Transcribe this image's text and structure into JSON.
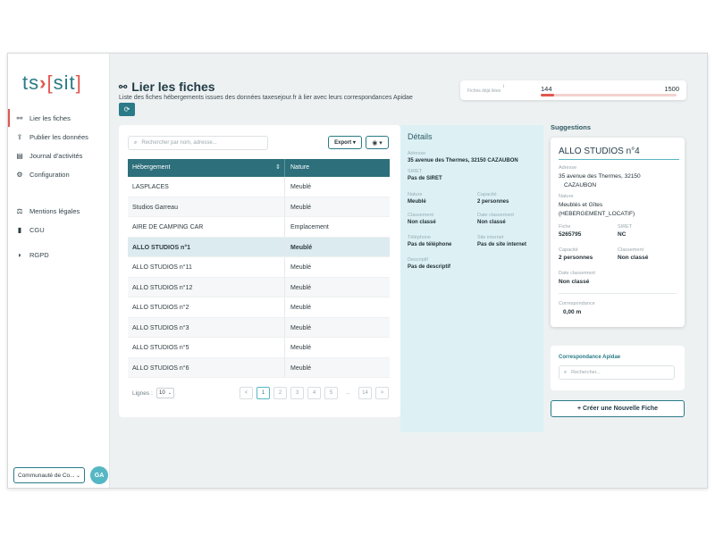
{
  "logo": {
    "left": "ts",
    "arrow": "›",
    "open": "[",
    "right": "sit",
    "close": "]"
  },
  "sidebar": {
    "items": [
      {
        "label": "Lier les fiches",
        "icon": "link-icon",
        "glyph": "⚯"
      },
      {
        "label": "Publier les données",
        "icon": "upload-icon",
        "glyph": "⇪"
      },
      {
        "label": "Journal d'activités",
        "icon": "journal-icon",
        "glyph": "▤"
      },
      {
        "label": "Configuration",
        "icon": "config-icon",
        "glyph": "⚙"
      },
      {
        "label": "Mentions légales",
        "icon": "legal-icon",
        "glyph": "⚖"
      },
      {
        "label": "CGU",
        "icon": "book-icon",
        "glyph": "▮"
      },
      {
        "label": "RGPD",
        "icon": "shield-icon",
        "glyph": "◗"
      }
    ],
    "org_select": "Communauté de Co...",
    "avatar": "GA"
  },
  "header": {
    "title": "Lier les fiches",
    "subtitle": "Liste des fiches hébergements issues des données taxesejour.fr à lier avec leurs correspondances Apidae",
    "refresh_glyph": "⟳"
  },
  "progress": {
    "label": "Fiches déjà liées",
    "info": "i",
    "current": "144",
    "max": "1500",
    "fraction": 0.096
  },
  "list": {
    "search_placeholder": "Rechercher par nom, adresse...",
    "export_label": "Export ▾",
    "eye_label": "◉ ▾",
    "columns": [
      "Hébergement",
      "Nature"
    ],
    "sort_glyph": "⇕",
    "rows": [
      {
        "name": "LASPLACES",
        "nature": "Meublé"
      },
      {
        "name": "Studios Garreau",
        "nature": "Meublé"
      },
      {
        "name": "AIRE DE CAMPING CAR",
        "nature": "Emplacement"
      },
      {
        "name": "ALLO STUDIOS n°1",
        "nature": "Meublé"
      },
      {
        "name": "ALLO STUDIOS n°11",
        "nature": "Meublé"
      },
      {
        "name": "ALLO STUDIOS n°12",
        "nature": "Meublé"
      },
      {
        "name": "ALLO STUDIOS n°2",
        "nature": "Meublé"
      },
      {
        "name": "ALLO STUDIOS n°3",
        "nature": "Meublé"
      },
      {
        "name": "ALLO STUDIOS n°5",
        "nature": "Meublé"
      },
      {
        "name": "ALLO STUDIOS n°6",
        "nature": "Meublé"
      }
    ],
    "selected_row": 3,
    "lines_label": "Lignes :",
    "lines_value": "10",
    "pager": [
      "<",
      "1",
      "2",
      "3",
      "4",
      "5",
      "...",
      "14",
      ">"
    ],
    "current_page": "1"
  },
  "details": {
    "title": "Détails",
    "adresse_label": "Adresse",
    "adresse_value": "35 avenue des Thermes, 32150 CAZAUBON",
    "siret_label": "SIRET",
    "siret_value": "Pas de SIRET",
    "nature_label": "Nature",
    "nature_value": "Meublé",
    "capacite_label": "Capacité",
    "capacite_value": "2 personnes",
    "classement_label": "Classement",
    "classement_value": "Non classé",
    "date_label": "Date classement",
    "date_value": "Non classé",
    "tel_label": "Téléphone",
    "tel_value": "Pas de téléphone",
    "site_label": "Site internet",
    "site_value": "Pas de site internet",
    "desc_label": "Descriptif",
    "desc_value": "Pas de descriptif"
  },
  "suggestions": {
    "title": "Suggestions",
    "card": {
      "name": "ALLO STUDIOS n°4",
      "adresse_label": "Adresse",
      "adresse_line1": "35 avenue des Thermes, 32150",
      "adresse_line2": "CAZAUBON",
      "nature_label": "Nature",
      "nature_line1": "Meublés et Gîtes",
      "nature_line2": "(HEBERGEMENT_LOCATIF)",
      "fiche_label": "Fiche",
      "fiche_value": "5265795",
      "siret_label": "SIRET",
      "siret_value": "NC",
      "capacite_label": "Capacité",
      "capacite_value": "2 personnes",
      "classement_label": "Classement",
      "classement_value": "Non classé",
      "date_label": "Date classement",
      "date_value": "Non classé",
      "corr_label": "Correspondance",
      "corr_value": "0,00 m"
    },
    "apidae_title": "Correspondance Apidae",
    "apidae_placeholder": "Rechercher...",
    "new_button": "+ Créer une Nouvelle Fiche"
  },
  "colors": {
    "accent": "#2a7b87",
    "brand_red": "#e0574f",
    "details_bg": "#ddf1f5",
    "header_bg": "#2d6f7b"
  }
}
